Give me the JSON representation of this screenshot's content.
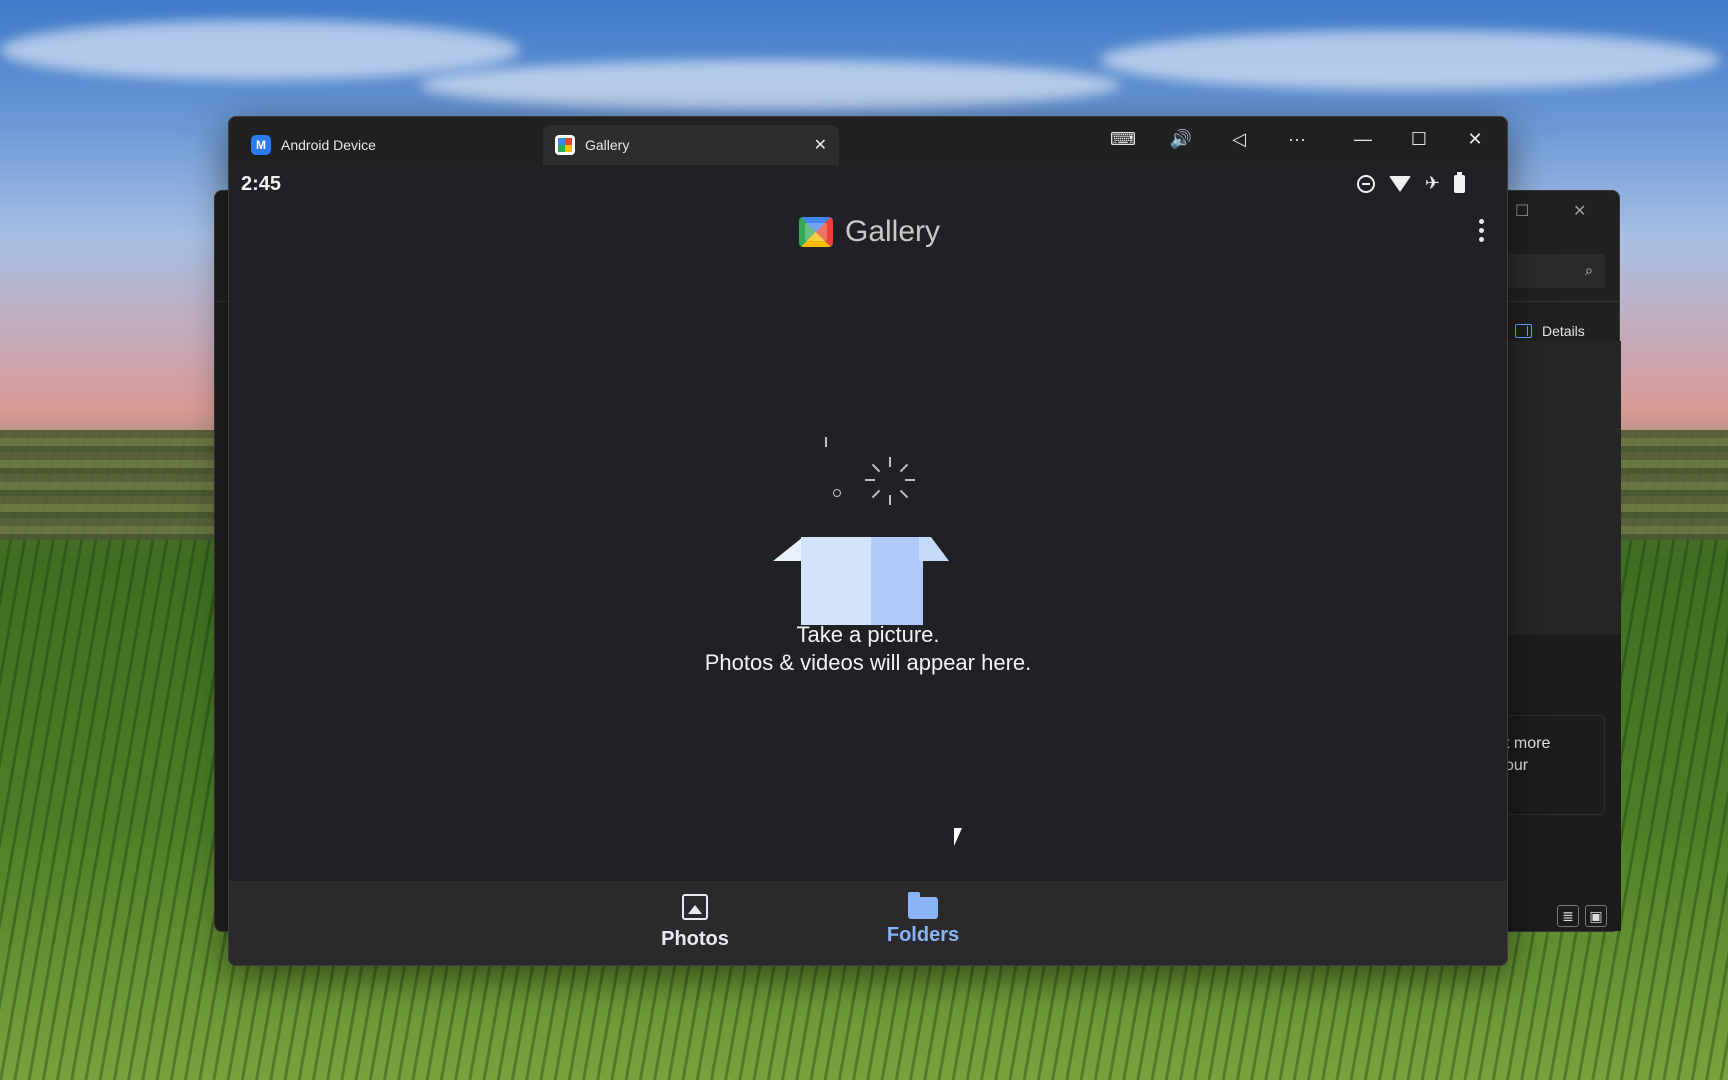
{
  "desktop": {
    "wallpaper": "sky-and-cornfield"
  },
  "background_window": {
    "details_label": "Details",
    "tip_text_line1": "t more",
    "tip_text_line2": "our"
  },
  "window": {
    "tabs": [
      {
        "label": "Android Device",
        "icon": "android-device-icon"
      },
      {
        "label": "Gallery",
        "icon": "gallery-icon"
      }
    ],
    "controls": {
      "keyboard": "⌨",
      "volume": "🔊",
      "back": "◁",
      "more": "···",
      "minimize": "—",
      "maximize": "☐",
      "close": "✕"
    }
  },
  "status_bar": {
    "time": "2:45"
  },
  "app": {
    "title": "Gallery",
    "empty_line1": "Take a picture.",
    "empty_line2": "Photos & videos will appear here."
  },
  "bottom_nav": {
    "items": [
      {
        "label": "Photos",
        "selected": false
      },
      {
        "label": "Folders",
        "selected": true
      }
    ],
    "accent_color": "#8ab4f8"
  }
}
